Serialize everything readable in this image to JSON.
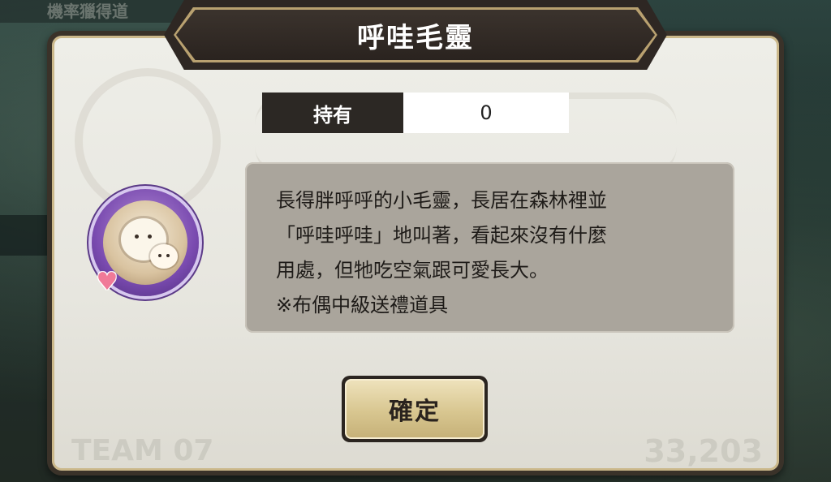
{
  "background": {
    "top_text": "機率獵得道",
    "footer_left": "TEAM 07",
    "footer_right": "33,203"
  },
  "dialog": {
    "title": "呼哇毛靈",
    "owned_label": "持有",
    "owned_value": "0",
    "item_icon": "fluffy-spirit-icon",
    "badge_icon": "heart-icon",
    "description_lines": [
      "長得胖呼呼的小毛靈，長居在森林裡並",
      "「呼哇呼哇」地叫著，看起來沒有什麼",
      "用處，但牠吃空氣跟可愛長大。",
      "※布偶中級送禮道具"
    ],
    "confirm_label": "確定"
  },
  "colors": {
    "panel": "#e7e6df",
    "title_plate": "#2e2723",
    "desc_box": "#aaa59c",
    "button": "#d8c690",
    "icon_ring": "#7a4bb0",
    "heart": "#f07a98"
  }
}
